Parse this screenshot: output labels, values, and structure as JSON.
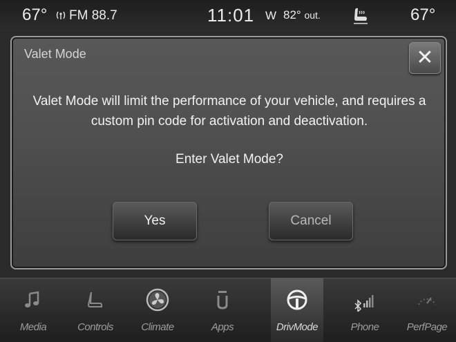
{
  "status_bar": {
    "temp_left": "67°",
    "radio_icon": "radio-antenna-icon",
    "radio_station": "FM 88.7",
    "time": "11:01",
    "compass": "W",
    "outside_temp_value": "82°",
    "outside_temp_suffix": "out.",
    "seat_icon": "heated-seat-icon",
    "temp_right": "67°"
  },
  "dialog": {
    "title": "Valet Mode",
    "close_icon": "close-icon",
    "message": "Valet Mode will limit the performance of your vehicle, and requires a custom pin code for activation and deactivation.",
    "question": "Enter Valet Mode?",
    "yes_label": "Yes",
    "cancel_label": "Cancel"
  },
  "nav": {
    "active": "DrivMode",
    "items": [
      {
        "label": "Media",
        "icon": "music-note-icon"
      },
      {
        "label": "Controls",
        "icon": "seat-icon"
      },
      {
        "label": "Climate",
        "icon": "fan-icon"
      },
      {
        "label": "Apps",
        "icon": "apps-icon"
      },
      {
        "label": "DrivMode",
        "icon": "steering-wheel-icon"
      },
      {
        "label": "Phone",
        "icon": "bluetooth-signal-icon"
      },
      {
        "label": "PerfPage",
        "icon": "gauge-icon"
      }
    ]
  }
}
